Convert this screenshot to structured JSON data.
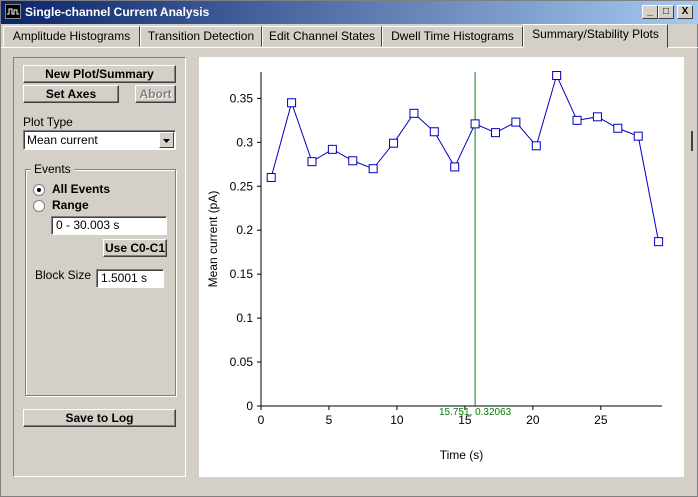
{
  "window": {
    "title": "Single-channel Current Analysis",
    "controls": [
      "_",
      "□",
      "X"
    ]
  },
  "tabs": [
    {
      "label": "Amplitude Histograms",
      "active": false
    },
    {
      "label": "Transition Detection",
      "active": false
    },
    {
      "label": "Edit Channel States",
      "active": false
    },
    {
      "label": "Dwell Time Histograms",
      "active": false
    },
    {
      "label": "Summary/Stability Plots",
      "active": true
    }
  ],
  "panel": {
    "new_plot_label": "New Plot/Summary",
    "set_axes_label": "Set Axes",
    "abort_label": "Abort",
    "plot_type_label": "Plot Type",
    "plot_type_value": "Mean current",
    "events_label": "Events",
    "all_events_label": "All Events",
    "range_label": "Range",
    "range_value": "0 - 30.003 s",
    "use_c0c1_label": "Use C0-C1",
    "block_size_label": "Block Size",
    "block_size_value": "1.5001 s",
    "save_to_log_label": "Save to Log",
    "selected_events": "All Events"
  },
  "chart_data": {
    "type": "line",
    "xlabel": "Time (s)",
    "ylabel": "Mean current (pA)",
    "xlim": [
      0,
      29.5
    ],
    "ylim": [
      0,
      0.38
    ],
    "xticks": [
      "0",
      "5",
      "10",
      "15",
      "20",
      "25"
    ],
    "yticks": [
      "0",
      "0.05",
      "0.1",
      "0.15",
      "0.2",
      "0.25",
      "0.3",
      "0.35"
    ],
    "series": [
      {
        "color": "#0000c0",
        "marker": "square",
        "x": [
          0.75,
          2.25,
          3.75,
          5.25,
          6.75,
          8.25,
          9.75,
          11.25,
          12.75,
          14.25,
          15.75,
          17.25,
          18.75,
          20.25,
          21.75,
          23.25,
          24.75,
          26.25,
          27.75,
          29.25
        ],
        "y": [
          0.26,
          0.345,
          0.278,
          0.292,
          0.279,
          0.27,
          0.299,
          0.333,
          0.312,
          0.272,
          0.321,
          0.311,
          0.323,
          0.296,
          0.376,
          0.325,
          0.329,
          0.316,
          0.307,
          0.187
        ]
      }
    ],
    "cursor": {
      "x": 15.751,
      "label": "15.751, 0.32063",
      "color": "#008000"
    },
    "grid": false
  }
}
